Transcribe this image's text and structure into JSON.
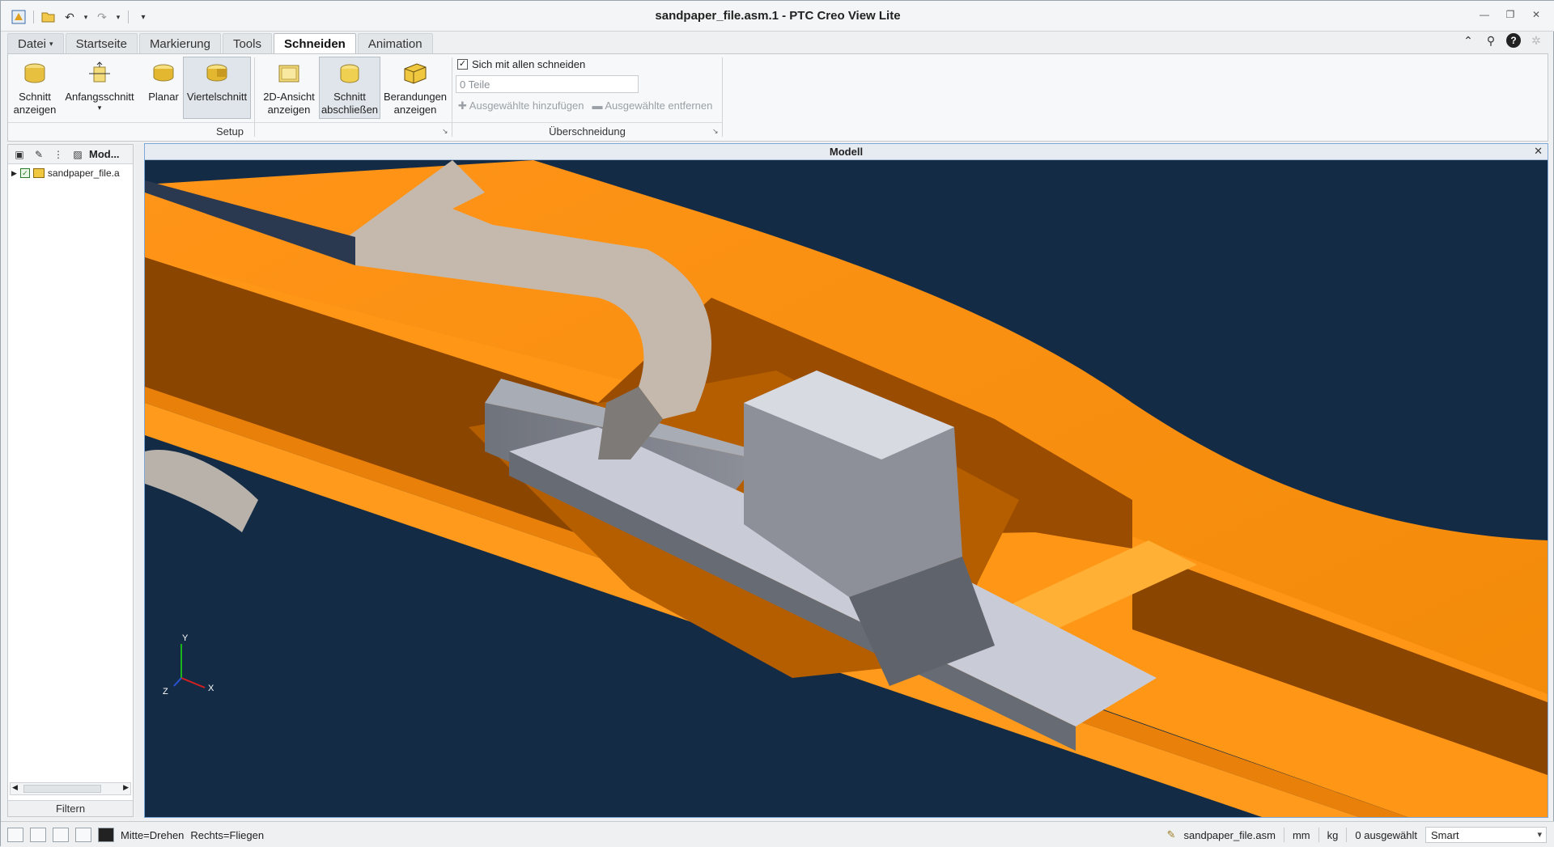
{
  "window": {
    "title": "sandpaper_file.asm.1 - PTC Creo View Lite",
    "controls": [
      "minimize-icon",
      "restore-icon",
      "close-icon"
    ]
  },
  "quick_access": [
    "app-icon",
    "open-icon",
    "undo-icon",
    "redo-icon",
    "customize-icon"
  ],
  "tabs": [
    {
      "label": "Datei",
      "dropdown": true
    },
    {
      "label": "Startseite"
    },
    {
      "label": "Markierung"
    },
    {
      "label": "Tools"
    },
    {
      "label": "Schneiden",
      "active": true
    },
    {
      "label": "Animation"
    }
  ],
  "ribbon": {
    "buttons": [
      {
        "line1": "Schnitt",
        "line2": "anzeigen",
        "icon": "section-show-icon"
      },
      {
        "line1": "Anfangsschnitt",
        "line2": "▾",
        "icon": "initial-section-icon"
      },
      {
        "line1": "Planar",
        "line2": "",
        "icon": "planar-icon"
      },
      {
        "line1": "Viertelschnitt",
        "line2": "",
        "icon": "quarter-section-icon",
        "active": true
      },
      {
        "line1": "2D-Ansicht",
        "line2": "anzeigen",
        "icon": "view-2d-icon"
      },
      {
        "line1": "Schnitt",
        "line2": "abschließen",
        "icon": "cap-section-icon",
        "active": true
      },
      {
        "line1": "Berandungen",
        "line2": "anzeigen",
        "icon": "show-edges-icon"
      }
    ],
    "groups": {
      "setup": "Setup",
      "intersection": "Überschneidung"
    },
    "intersection": {
      "checkbox_label": "Sich mit allen schneiden",
      "checkbox_checked": true,
      "parts_value": "0 Teile",
      "add_selected": "Ausgewählte hinzufügen",
      "remove_selected": "Ausgewählte entfernen"
    }
  },
  "left_panel": {
    "header": "Mod...",
    "tree_item": "sandpaper_file.a",
    "filter": "Filtern"
  },
  "viewport": {
    "title": "Modell",
    "triad": {
      "y": "Y",
      "x": "X",
      "z": "Z"
    }
  },
  "status": {
    "mouse_hint_1": "Mitte=Drehen",
    "mouse_hint_2": "Rechts=Fliegen",
    "file": "sandpaper_file.asm",
    "unit_length": "mm",
    "unit_mass": "kg",
    "selected": "0 ausgewählt",
    "filter_mode": "Smart"
  }
}
